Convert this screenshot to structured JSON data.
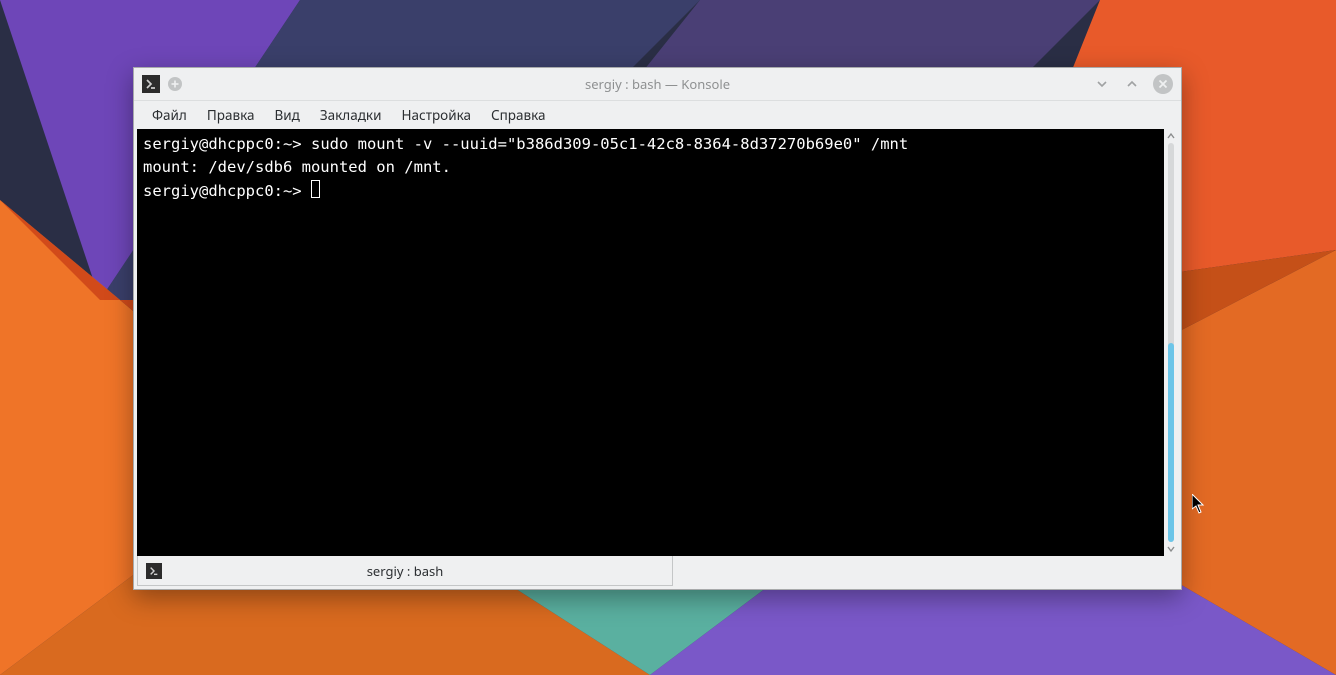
{
  "window": {
    "title": "sergiy : bash — Konsole"
  },
  "menu": {
    "items": [
      "Файл",
      "Правка",
      "Вид",
      "Закладки",
      "Настройка",
      "Справка"
    ]
  },
  "terminal": {
    "lines": [
      {
        "prompt": "sergiy@dhcppc0:~> ",
        "cmd": "sudo mount -v --uuid=\"b386d309-05c1-42c8-8364-8d37270b69e0\" /mnt"
      },
      {
        "text": "mount: /dev/sdb6 mounted on /mnt."
      },
      {
        "prompt": "sergiy@dhcppc0:~> ",
        "cursor": true
      }
    ]
  },
  "tab": {
    "label": "sergiy : bash"
  },
  "icons": {
    "app_glyph": ">_",
    "newtab_glyph": "+",
    "close_glyph": "✕",
    "min_glyph": "˅",
    "max_glyph": "˄"
  }
}
